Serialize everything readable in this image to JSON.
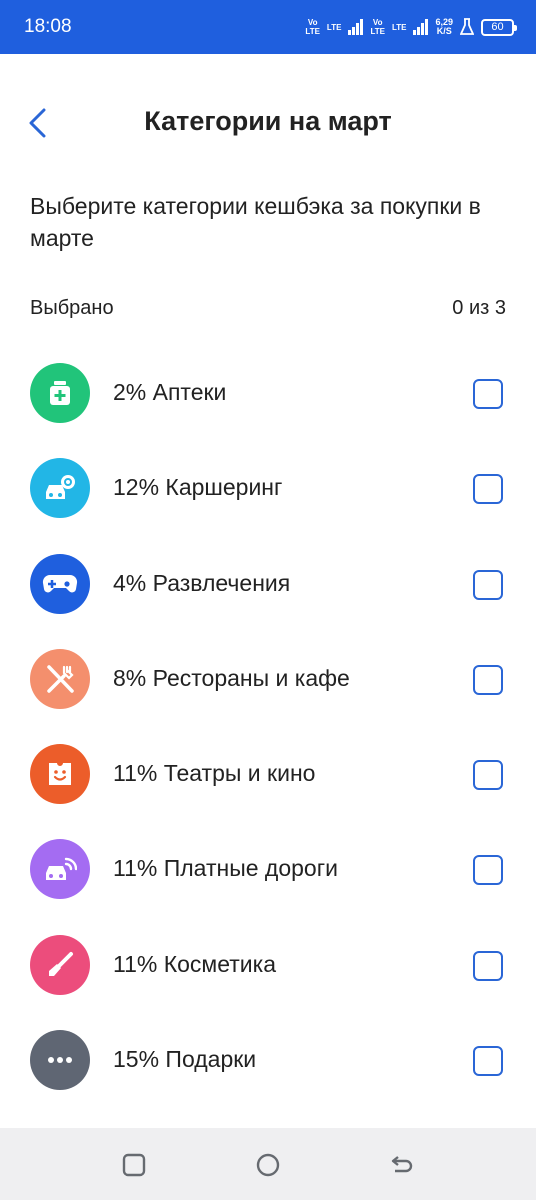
{
  "status_bar": {
    "time": "18:08",
    "net1_top": "Vo",
    "net1_bottom": "LTE",
    "lte1": "LTE",
    "net2_top": "Vo",
    "net2_bottom": "LTE",
    "lte2": "LTE",
    "speed_value": "6,29",
    "speed_unit": "K/S",
    "battery": "60"
  },
  "header": {
    "title": "Категории на март",
    "back_icon": "chevron-left-icon"
  },
  "subtitle": "Выберите категории кешбэка за покупки в марте",
  "selection": {
    "label": "Выбрано",
    "count": "0 из 3"
  },
  "categories": [
    {
      "label": "2% Аптеки",
      "icon": "pharmacy-icon",
      "color": "#21c47a",
      "checked": false
    },
    {
      "label": "12% Каршеринг",
      "icon": "carsharing-icon",
      "color": "#22b6e6",
      "checked": false
    },
    {
      "label": "4% Развлечения",
      "icon": "gamepad-icon",
      "color": "#1f5fde",
      "checked": false
    },
    {
      "label": "8% Рестораны и кафе",
      "icon": "fork-knife-icon",
      "color": "#f48f6d",
      "checked": false
    },
    {
      "label": "11% Театры и кино",
      "icon": "ticket-icon",
      "color": "#ec5d2a",
      "checked": false
    },
    {
      "label": "11% Платные дороги",
      "icon": "toll-car-icon",
      "color": "#a46cf2",
      "checked": false
    },
    {
      "label": "11% Косметика",
      "icon": "brush-icon",
      "color": "#ec4d7c",
      "checked": false
    },
    {
      "label": "15% Подарки",
      "icon": "more-dots-icon",
      "color": "#5f6673",
      "checked": false
    }
  ],
  "nav_bar": {
    "accent": "#666a70"
  }
}
